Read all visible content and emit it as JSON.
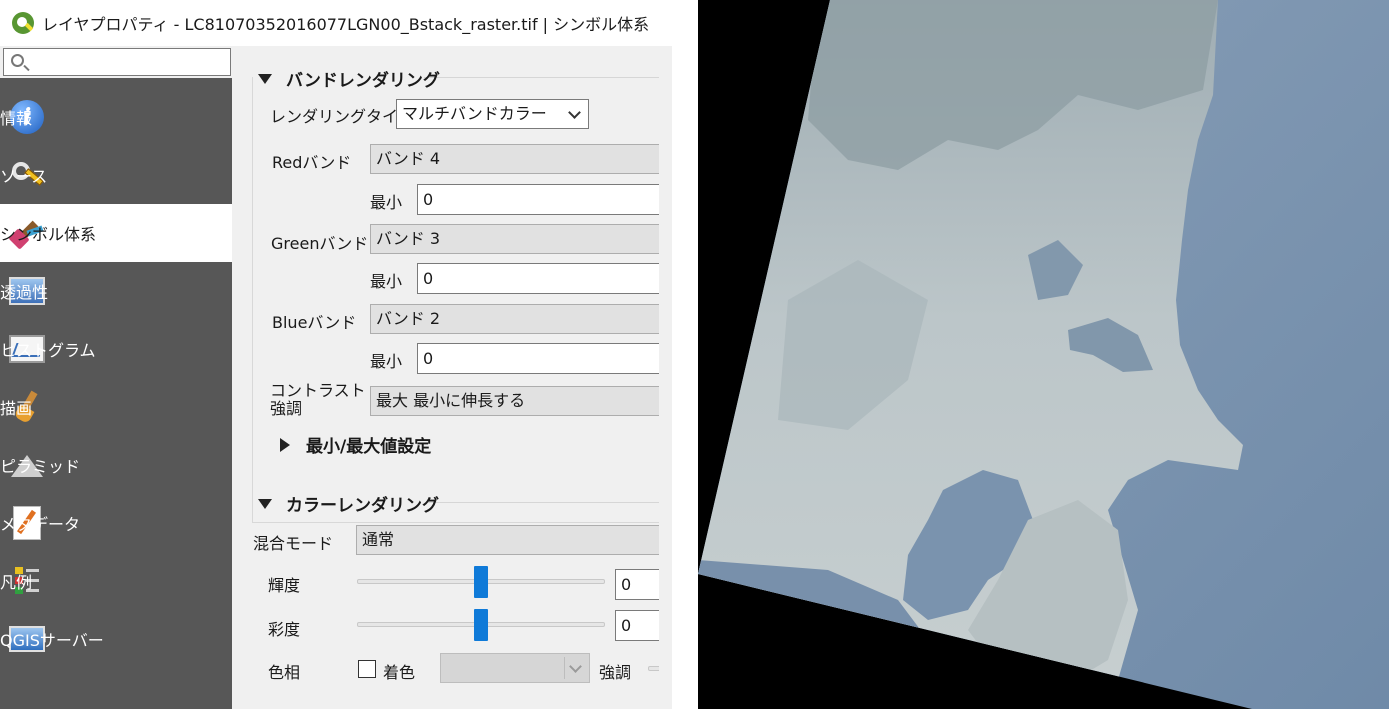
{
  "window": {
    "title": "レイヤプロパティ - LC81070352016077LGN00_Bstack_raster.tif | シンボル体系"
  },
  "search": {
    "placeholder": "",
    "value": ""
  },
  "sidebar": {
    "items": [
      {
        "label": "情報",
        "icon": "info-icon",
        "active": false
      },
      {
        "label": "ソース",
        "icon": "source-tools-icon",
        "active": false
      },
      {
        "label": "シンボル体系",
        "icon": "symbology-brush-icon",
        "active": true
      },
      {
        "label": "透過性",
        "icon": "transparency-icon",
        "active": false
      },
      {
        "label": "ヒストグラム",
        "icon": "histogram-icon",
        "active": false
      },
      {
        "label": "描画",
        "icon": "rendering-brush-icon",
        "active": false
      },
      {
        "label": "ピラミッド",
        "icon": "pyramids-icon",
        "active": false
      },
      {
        "label": "メタデータ",
        "icon": "metadata-icon",
        "active": false
      },
      {
        "label": "凡例",
        "icon": "legend-icon",
        "active": false
      },
      {
        "label": "QGISサーバー",
        "icon": "qgis-server-icon",
        "active": false
      }
    ]
  },
  "band_rendering": {
    "section_title": "バンドレンダリング",
    "render_type_label": "レンダリングタイプ",
    "render_type_value": "マルチバンドカラー",
    "red_label": "Redバンド",
    "red_value": "バンド 4",
    "red_min_label": "最小",
    "red_min_value": "0",
    "green_label": "Greenバンド",
    "green_value": "バンド 3",
    "green_min_label": "最小",
    "green_min_value": "0",
    "blue_label": "Blueバンド",
    "blue_value": "バンド 2",
    "blue_min_label": "最小",
    "blue_min_value": "0",
    "contrast_label_line1": "コントラスト",
    "contrast_label_line2": "強調",
    "contrast_value": "最大 最小に伸長する",
    "minmax_section_title": "最小/最大値設定"
  },
  "color_rendering": {
    "section_title": "カラーレンダリング",
    "blend_label": "混合モード",
    "blend_value": "通常",
    "brightness_label": "輝度",
    "brightness_value": "0",
    "brightness_slider_fraction": 0.5,
    "saturation_label": "彩度",
    "saturation_value": "0",
    "saturation_slider_fraction": 0.5,
    "hue_label": "色相",
    "colorize_label": "着色",
    "colorize_checked": false,
    "strength_label": "強調"
  },
  "colors": {
    "sidebar_bg": "#575757",
    "panel_bg": "#f0f0f0",
    "slider_thumb": "#0f7ad8",
    "ocean": "#7d94b0",
    "land": "#b8c3c6"
  }
}
